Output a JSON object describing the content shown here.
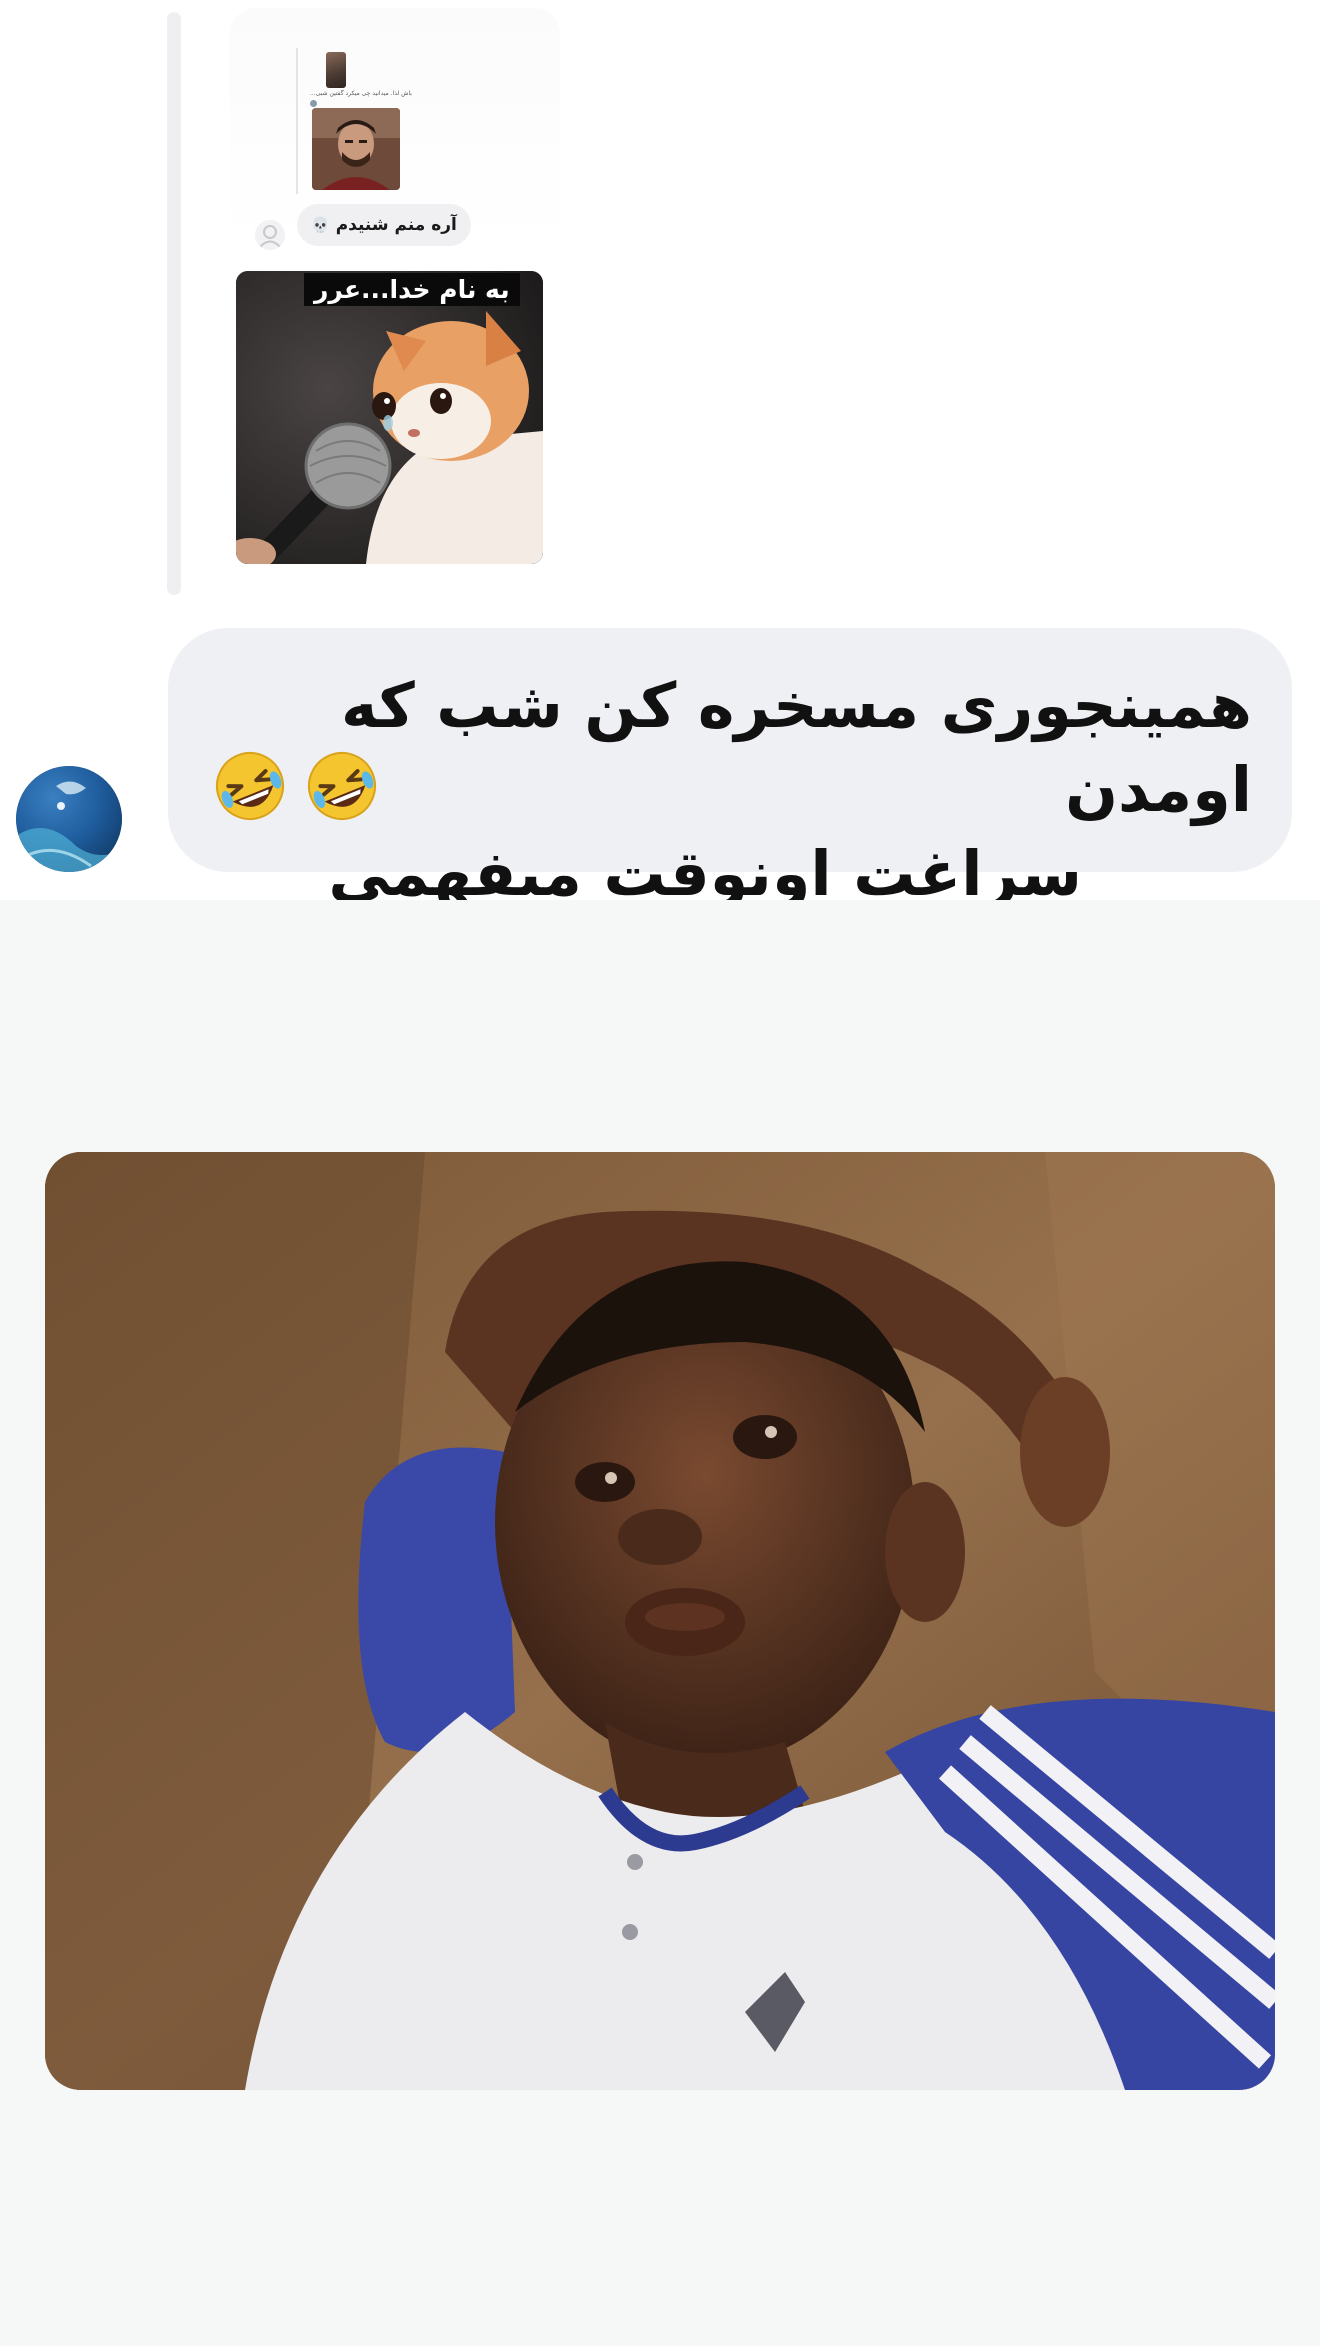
{
  "shared_post": {
    "mini_caption": "باش لذا. میدانید چی میکرد گفتین شبی..."
  },
  "reply": {
    "text": "آره منم شنیدم",
    "icon": "skull-icon"
  },
  "sticker": {
    "caption": "به نام خدا...عرر"
  },
  "message": {
    "line1": "همینجوری مسخره کن شب که اومدن",
    "line2": "سراغت اونوقت میفهمی",
    "emojis": [
      "rofl-icon",
      "rofl-icon"
    ]
  },
  "colors": {
    "bubble": "#eff0f3",
    "background_bottom": "#f6f7f7",
    "text": "#111111"
  }
}
